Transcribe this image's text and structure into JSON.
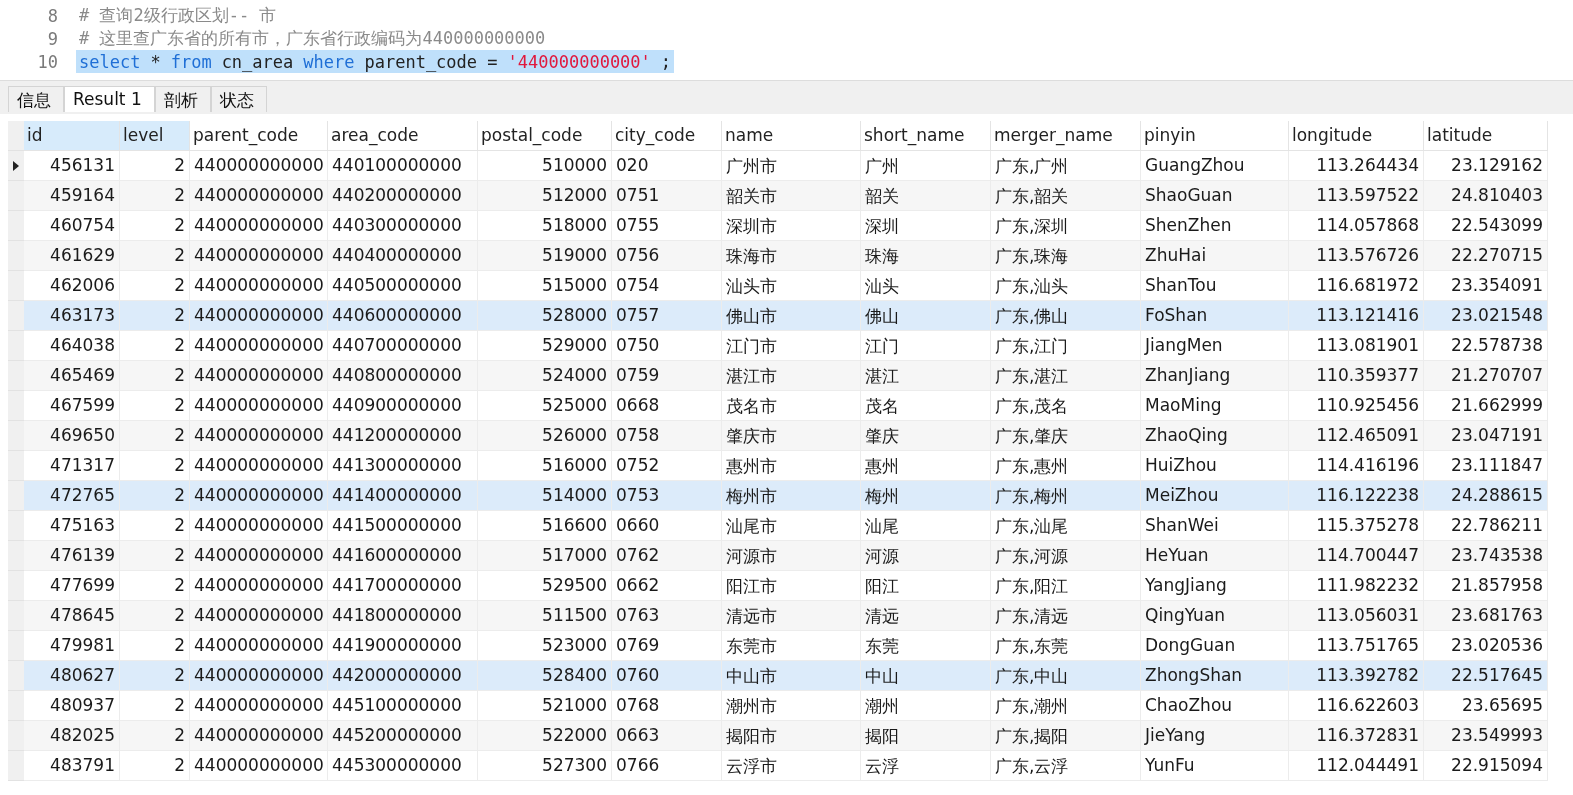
{
  "editor": {
    "lines": [
      {
        "number": "8",
        "kind": "comment",
        "text": "# 查询2级行政区划-- 市",
        "selected": false
      },
      {
        "number": "9",
        "kind": "comment",
        "text": "# 这里查广东省的所有市，广东省行政编码为440000000000",
        "selected": false
      },
      {
        "number": "10",
        "kind": "sql",
        "tokens": [
          {
            "kind": "keyword",
            "text": "select"
          },
          {
            "kind": "plain",
            "text": "*"
          },
          {
            "kind": "keyword",
            "text": "from"
          },
          {
            "kind": "plain",
            "text": "cn_area"
          },
          {
            "kind": "keyword",
            "text": "where"
          },
          {
            "kind": "plain",
            "text": "parent_code ="
          },
          {
            "kind": "string",
            "text": "'440000000000'"
          },
          {
            "kind": "plain",
            "text": ";"
          }
        ],
        "selected": true
      }
    ]
  },
  "tabs": [
    {
      "label": "信息",
      "selected": false
    },
    {
      "label": "Result 1",
      "selected": true
    },
    {
      "label": "剖析",
      "selected": false
    },
    {
      "label": "状态",
      "selected": false
    }
  ],
  "table": {
    "columns": [
      {
        "label": "id",
        "selected": true
      },
      {
        "label": "level",
        "selected": true
      },
      {
        "label": "parent_code",
        "selected": false
      },
      {
        "label": "area_code",
        "selected": false
      },
      {
        "label": "postal_code",
        "selected": false
      },
      {
        "label": "city_code",
        "selected": false
      },
      {
        "label": "name",
        "selected": false
      },
      {
        "label": "short_name",
        "selected": false
      },
      {
        "label": "merger_name",
        "selected": false
      },
      {
        "label": "pinyin",
        "selected": false
      },
      {
        "label": "longitude",
        "selected": false
      },
      {
        "label": "latitude",
        "selected": false
      }
    ],
    "rows": [
      {
        "selected": true,
        "highlighted": false,
        "cells": [
          "456131",
          "2",
          "440000000000",
          "440100000000",
          "510000",
          "020",
          "广州市",
          "广州",
          "广东,广州",
          "GuangZhou",
          "113.264434",
          "23.129162"
        ]
      },
      {
        "selected": false,
        "highlighted": false,
        "cells": [
          "459164",
          "2",
          "440000000000",
          "440200000000",
          "512000",
          "0751",
          "韶关市",
          "韶关",
          "广东,韶关",
          "ShaoGuan",
          "113.597522",
          "24.810403"
        ]
      },
      {
        "selected": false,
        "highlighted": false,
        "cells": [
          "460754",
          "2",
          "440000000000",
          "440300000000",
          "518000",
          "0755",
          "深圳市",
          "深圳",
          "广东,深圳",
          "ShenZhen",
          "114.057868",
          "22.543099"
        ]
      },
      {
        "selected": false,
        "highlighted": false,
        "cells": [
          "461629",
          "2",
          "440000000000",
          "440400000000",
          "519000",
          "0756",
          "珠海市",
          "珠海",
          "广东,珠海",
          "ZhuHai",
          "113.576726",
          "22.270715"
        ]
      },
      {
        "selected": false,
        "highlighted": false,
        "cells": [
          "462006",
          "2",
          "440000000000",
          "440500000000",
          "515000",
          "0754",
          "汕头市",
          "汕头",
          "广东,汕头",
          "ShanTou",
          "116.681972",
          "23.354091"
        ]
      },
      {
        "selected": false,
        "highlighted": true,
        "cells": [
          "463173",
          "2",
          "440000000000",
          "440600000000",
          "528000",
          "0757",
          "佛山市",
          "佛山",
          "广东,佛山",
          "FoShan",
          "113.121416",
          "23.021548"
        ]
      },
      {
        "selected": false,
        "highlighted": false,
        "cells": [
          "464038",
          "2",
          "440000000000",
          "440700000000",
          "529000",
          "0750",
          "江门市",
          "江门",
          "广东,江门",
          "JiangMen",
          "113.081901",
          "22.578738"
        ]
      },
      {
        "selected": false,
        "highlighted": false,
        "cells": [
          "465469",
          "2",
          "440000000000",
          "440800000000",
          "524000",
          "0759",
          "湛江市",
          "湛江",
          "广东,湛江",
          "ZhanJiang",
          "110.359377",
          "21.270707"
        ]
      },
      {
        "selected": false,
        "highlighted": false,
        "cells": [
          "467599",
          "2",
          "440000000000",
          "440900000000",
          "525000",
          "0668",
          "茂名市",
          "茂名",
          "广东,茂名",
          "MaoMing",
          "110.925456",
          "21.662999"
        ]
      },
      {
        "selected": false,
        "highlighted": false,
        "cells": [
          "469650",
          "2",
          "440000000000",
          "441200000000",
          "526000",
          "0758",
          "肇庆市",
          "肇庆",
          "广东,肇庆",
          "ZhaoQing",
          "112.465091",
          "23.047191"
        ]
      },
      {
        "selected": false,
        "highlighted": false,
        "cells": [
          "471317",
          "2",
          "440000000000",
          "441300000000",
          "516000",
          "0752",
          "惠州市",
          "惠州",
          "广东,惠州",
          "HuiZhou",
          "114.416196",
          "23.111847"
        ]
      },
      {
        "selected": false,
        "highlighted": true,
        "cells": [
          "472765",
          "2",
          "440000000000",
          "441400000000",
          "514000",
          "0753",
          "梅州市",
          "梅州",
          "广东,梅州",
          "MeiZhou",
          "116.122238",
          "24.288615"
        ]
      },
      {
        "selected": false,
        "highlighted": false,
        "cells": [
          "475163",
          "2",
          "440000000000",
          "441500000000",
          "516600",
          "0660",
          "汕尾市",
          "汕尾",
          "广东,汕尾",
          "ShanWei",
          "115.375278",
          "22.786211"
        ]
      },
      {
        "selected": false,
        "highlighted": false,
        "cells": [
          "476139",
          "2",
          "440000000000",
          "441600000000",
          "517000",
          "0762",
          "河源市",
          "河源",
          "广东,河源",
          "HeYuan",
          "114.700447",
          "23.743538"
        ]
      },
      {
        "selected": false,
        "highlighted": false,
        "cells": [
          "477699",
          "2",
          "440000000000",
          "441700000000",
          "529500",
          "0662",
          "阳江市",
          "阳江",
          "广东,阳江",
          "YangJiang",
          "111.982232",
          "21.857958"
        ]
      },
      {
        "selected": false,
        "highlighted": false,
        "cells": [
          "478645",
          "2",
          "440000000000",
          "441800000000",
          "511500",
          "0763",
          "清远市",
          "清远",
          "广东,清远",
          "QingYuan",
          "113.056031",
          "23.681763"
        ]
      },
      {
        "selected": false,
        "highlighted": false,
        "cells": [
          "479981",
          "2",
          "440000000000",
          "441900000000",
          "523000",
          "0769",
          "东莞市",
          "东莞",
          "广东,东莞",
          "DongGuan",
          "113.751765",
          "23.020536"
        ]
      },
      {
        "selected": false,
        "highlighted": true,
        "cells": [
          "480627",
          "2",
          "440000000000",
          "442000000000",
          "528400",
          "0760",
          "中山市",
          "中山",
          "广东,中山",
          "ZhongShan",
          "113.392782",
          "22.517645"
        ]
      },
      {
        "selected": false,
        "highlighted": false,
        "cells": [
          "480937",
          "2",
          "440000000000",
          "445100000000",
          "521000",
          "0768",
          "潮州市",
          "潮州",
          "广东,潮州",
          "ChaoZhou",
          "116.622603",
          "23.65695"
        ]
      },
      {
        "selected": false,
        "highlighted": false,
        "cells": [
          "482025",
          "2",
          "440000000000",
          "445200000000",
          "522000",
          "0663",
          "揭阳市",
          "揭阳",
          "广东,揭阳",
          "JieYang",
          "116.372831",
          "23.549993"
        ]
      },
      {
        "selected": false,
        "highlighted": false,
        "cells": [
          "483791",
          "2",
          "440000000000",
          "445300000000",
          "527300",
          "0766",
          "云浮市",
          "云浮",
          "广东,云浮",
          "YunFu",
          "112.044491",
          "22.915094"
        ]
      }
    ]
  }
}
